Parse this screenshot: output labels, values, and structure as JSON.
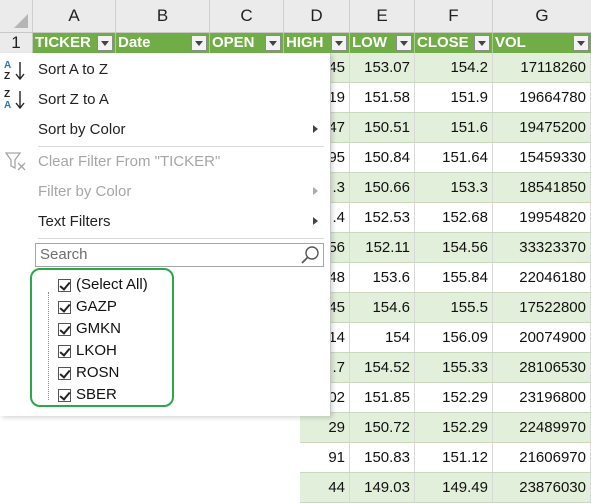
{
  "column_letters": [
    "A",
    "B",
    "C",
    "D",
    "E",
    "F",
    "G"
  ],
  "row_number": "1",
  "headers": [
    "TICKER",
    "Date",
    "OPEN",
    "HIGH",
    "LOW",
    "CLOSE",
    "VOL"
  ],
  "rows": [
    {
      "high_partial": "45",
      "low": "153.07",
      "close": "154.2",
      "vol": "17118260"
    },
    {
      "high_partial": "19",
      "low": "151.58",
      "close": "151.9",
      "vol": "19664780"
    },
    {
      "high_partial": "47",
      "low": "150.51",
      "close": "151.6",
      "vol": "19475200"
    },
    {
      "high_partial": "95",
      "low": "150.84",
      "close": "151.64",
      "vol": "15459330"
    },
    {
      "high_partial": ".3",
      "low": "150.66",
      "close": "153.3",
      "vol": "18541850"
    },
    {
      "high_partial": ".4",
      "low": "152.53",
      "close": "152.68",
      "vol": "19954820"
    },
    {
      "high_partial": "56",
      "low": "152.11",
      "close": "154.56",
      "vol": "33323370"
    },
    {
      "high_partial": "48",
      "low": "153.6",
      "close": "155.84",
      "vol": "22046180"
    },
    {
      "high_partial": "45",
      "low": "154.6",
      "close": "155.5",
      "vol": "17522800"
    },
    {
      "high_partial": "14",
      "low": "154",
      "close": "156.09",
      "vol": "20074900"
    },
    {
      "high_partial": ".7",
      "low": "154.52",
      "close": "155.33",
      "vol": "28106530"
    },
    {
      "high_partial": "02",
      "low": "151.85",
      "close": "152.29",
      "vol": "23196800"
    },
    {
      "high_partial": "29",
      "low": "150.72",
      "close": "152.29",
      "vol": "22489970"
    },
    {
      "high_partial": "91",
      "low": "150.83",
      "close": "151.12",
      "vol": "21606970"
    },
    {
      "high_partial": "44",
      "low": "149.03",
      "close": "149.49",
      "vol": "23876030"
    }
  ],
  "menu": {
    "sort_az": "Sort A to Z",
    "sort_za": "Sort Z to A",
    "sort_by_color": "Sort by Color",
    "clear_filter": "Clear Filter From \"TICKER\"",
    "filter_by_color": "Filter by Color",
    "text_filters": "Text Filters",
    "search_placeholder": "Search",
    "list": [
      {
        "label": "(Select All)",
        "checked": true
      },
      {
        "label": "GAZP",
        "checked": true
      },
      {
        "label": "GMKN",
        "checked": true
      },
      {
        "label": "LKOH",
        "checked": true
      },
      {
        "label": "ROSN",
        "checked": true
      },
      {
        "label": "SBER",
        "checked": true
      }
    ]
  },
  "colors": {
    "header_green": "#70ad47",
    "band_green": "#e2efda",
    "highlight_outline": "#2aa84a"
  },
  "icons": [
    "sort-az-icon",
    "sort-za-icon",
    "clear-filter-icon",
    "search-icon",
    "filter-dropdown-icon",
    "checkbox-checked-icon"
  ]
}
